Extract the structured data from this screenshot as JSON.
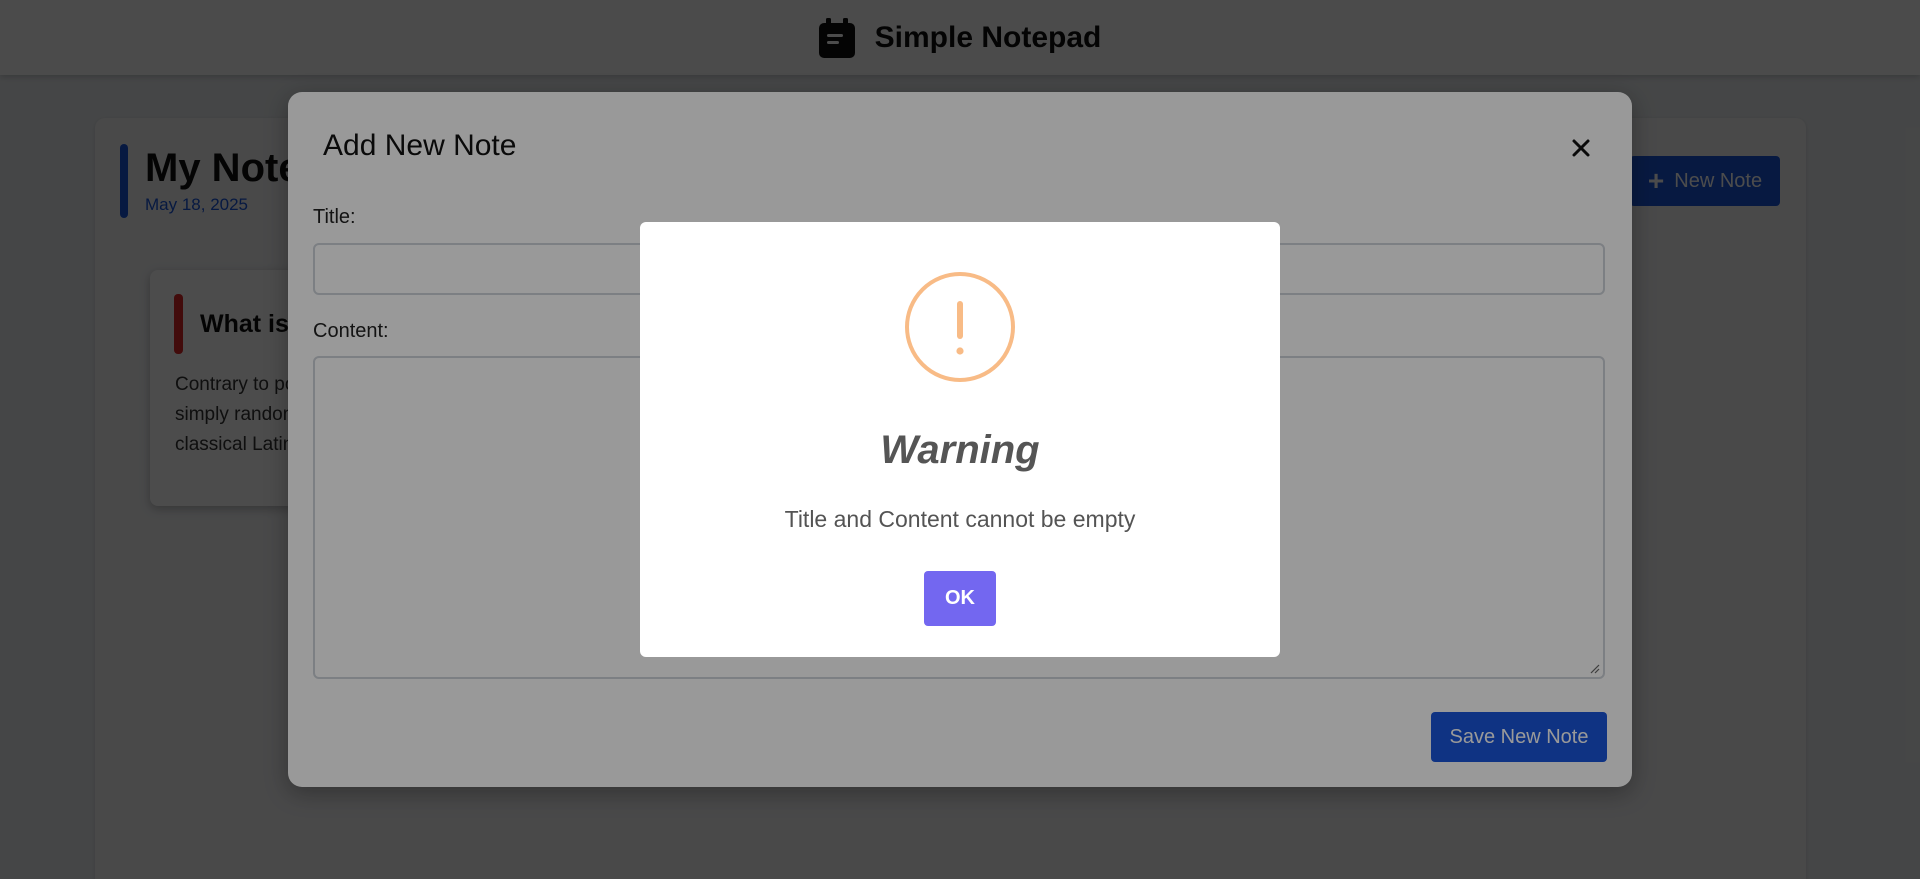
{
  "app": {
    "title": "Simple Notepad"
  },
  "notes_panel": {
    "title": "My Notes",
    "date": "May 18, 2025",
    "new_note_label": "New Note",
    "accent_color": "#1a56db"
  },
  "note_card": {
    "title": "What is Lorem Ipsum?",
    "body": "Contrary to popular belief, Lorem Ipsum is not simply random text. It has roots in a piece of classical Latin literature.",
    "accent_color": "#dc2626"
  },
  "add_note_modal": {
    "title": "Add New Note",
    "title_label": "Title:",
    "title_value": "",
    "content_label": "Content:",
    "content_value": "",
    "save_label": "Save New Note"
  },
  "alert": {
    "title": "Warning",
    "message": "Title and Content cannot be empty",
    "ok_label": "OK",
    "icon": "warning-icon",
    "icon_color": "#f8bb86",
    "button_color": "#7367f0"
  }
}
